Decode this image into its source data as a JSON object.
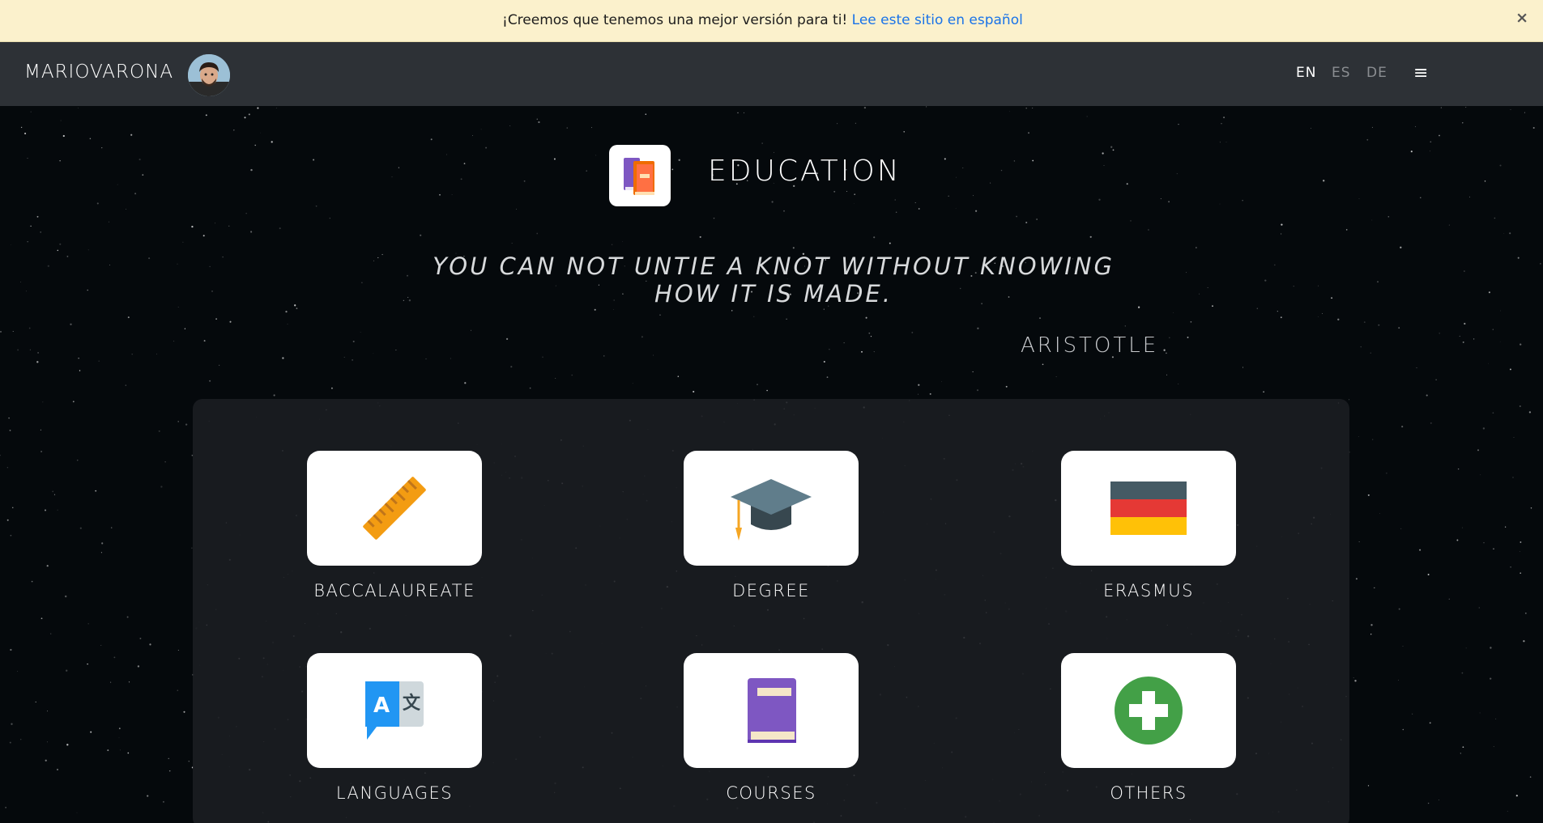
{
  "banner": {
    "message": "¡Creemos que tenemos una mejor versión para ti!",
    "link": "Lee este sitio en español",
    "close_glyph": "×"
  },
  "header": {
    "brand": "MARIOVARONA",
    "languages": [
      {
        "label": "EN",
        "active": true
      },
      {
        "label": "ES",
        "active": false
      },
      {
        "label": "DE",
        "active": false
      }
    ],
    "menu_glyph": "≡"
  },
  "section": {
    "title": "EDUCATION",
    "icon": "books-icon"
  },
  "quote": {
    "line1": "YOU CAN NOT UNTIE A KNOT WITHOUT KNOWING",
    "line2": "HOW IT IS MADE.",
    "author": "ARISTOTLE"
  },
  "cards": [
    {
      "label": "BACCALAUREATE",
      "icon": "ruler-icon"
    },
    {
      "label": "DEGREE",
      "icon": "graduation-cap-icon"
    },
    {
      "label": "ERASMUS",
      "icon": "germany-flag-icon"
    },
    {
      "label": "LANGUAGES",
      "icon": "translate-icon"
    },
    {
      "label": "COURSES",
      "icon": "book-icon"
    },
    {
      "label": "OTHERS",
      "icon": "plus-circle-icon"
    }
  ],
  "colors": {
    "banner_bg": "#fbf1cc",
    "link": "#1a73e8",
    "header_bg": "#2d3136",
    "page_bg": "#05090c"
  }
}
